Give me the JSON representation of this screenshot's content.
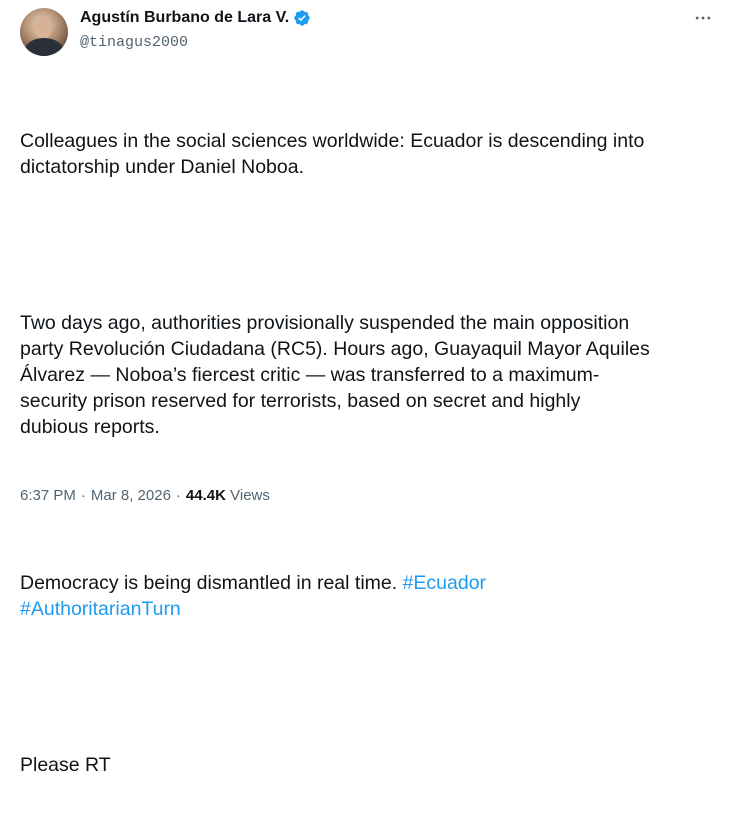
{
  "author": {
    "name": "Agustín Burbano de Lara V.",
    "handle": "@tinagus2000",
    "verified": true,
    "verified_color": "#1d9bf0"
  },
  "icons": {
    "more": "more-icon",
    "verified": "verified-badge-icon"
  },
  "tweet": {
    "para1": "Colleagues in the social sciences worldwide: Ecuador is descending into\ndictatorship under Daniel Noboa.",
    "para2": "Two days ago, authorities provisionally suspended the main opposition\nparty Revolución Ciudadana (RC5). Hours ago, Guayaquil Mayor Aquiles\nÁlvarez — Noboa’s fiercest critic — was transferred to a maximum-\nsecurity prison reserved for terrorists, based on secret and highly\ndubious reports.",
    "para3_text": "Democracy is being dismantled in real time. ",
    "hashtag1": "#Ecuador",
    "hashtag2": "#AuthoritarianTurn",
    "para4": "Please RT"
  },
  "meta": {
    "time": "6:37 PM",
    "separator": "·",
    "date": "Mar 8, 2026",
    "views_count": "44.4K",
    "views_label": "Views"
  },
  "colors": {
    "text": "#0f1419",
    "secondary": "#536471",
    "link": "#1d9bf0"
  }
}
